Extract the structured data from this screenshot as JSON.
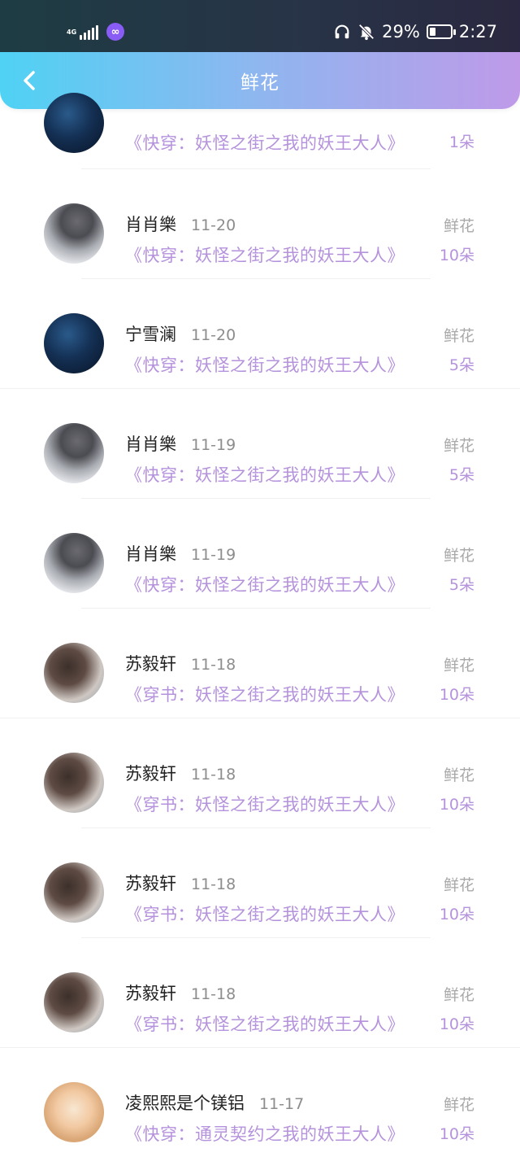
{
  "status_bar": {
    "network": "4G",
    "battery_percent": "29%",
    "battery_level": 0.29,
    "time": "2:27"
  },
  "header": {
    "title": "鲜花"
  },
  "gift_label": "鲜花",
  "items": [
    {
      "name": "",
      "date": "",
      "title": "《快穿：妖怪之街之我的妖王大人》",
      "count": "1朵",
      "avatar": "night-sky"
    },
    {
      "name": "肖肖樂",
      "date": "11-20",
      "title": "《快穿：妖怪之街之我的妖王大人》",
      "count": "10朵",
      "avatar": "helmet-boy"
    },
    {
      "name": "宁雪澜",
      "date": "11-20",
      "title": "《快穿：妖怪之街之我的妖王大人》",
      "count": "5朵",
      "avatar": "night-sky"
    },
    {
      "name": "肖肖樂",
      "date": "11-19",
      "title": "《快穿：妖怪之街之我的妖王大人》",
      "count": "5朵",
      "avatar": "helmet-boy"
    },
    {
      "name": "肖肖樂",
      "date": "11-19",
      "title": "《快穿：妖怪之街之我的妖王大人》",
      "count": "5朵",
      "avatar": "helmet-boy"
    },
    {
      "name": "苏毅轩",
      "date": "11-18",
      "title": "《穿书：妖怪之街之我的妖王大人》",
      "count": "10朵",
      "avatar": "anime-boy"
    },
    {
      "name": "苏毅轩",
      "date": "11-18",
      "title": "《穿书：妖怪之街之我的妖王大人》",
      "count": "10朵",
      "avatar": "anime-boy"
    },
    {
      "name": "苏毅轩",
      "date": "11-18",
      "title": "《穿书：妖怪之街之我的妖王大人》",
      "count": "10朵",
      "avatar": "anime-boy"
    },
    {
      "name": "苏毅轩",
      "date": "11-18",
      "title": "《穿书：妖怪之街之我的妖王大人》",
      "count": "10朵",
      "avatar": "anime-boy"
    },
    {
      "name": "凌熙熙是个镁铝",
      "date": "11-17",
      "title": "《快穿：通灵契约之我的妖王大人》",
      "count": "10朵",
      "avatar": "anime-girl"
    }
  ]
}
